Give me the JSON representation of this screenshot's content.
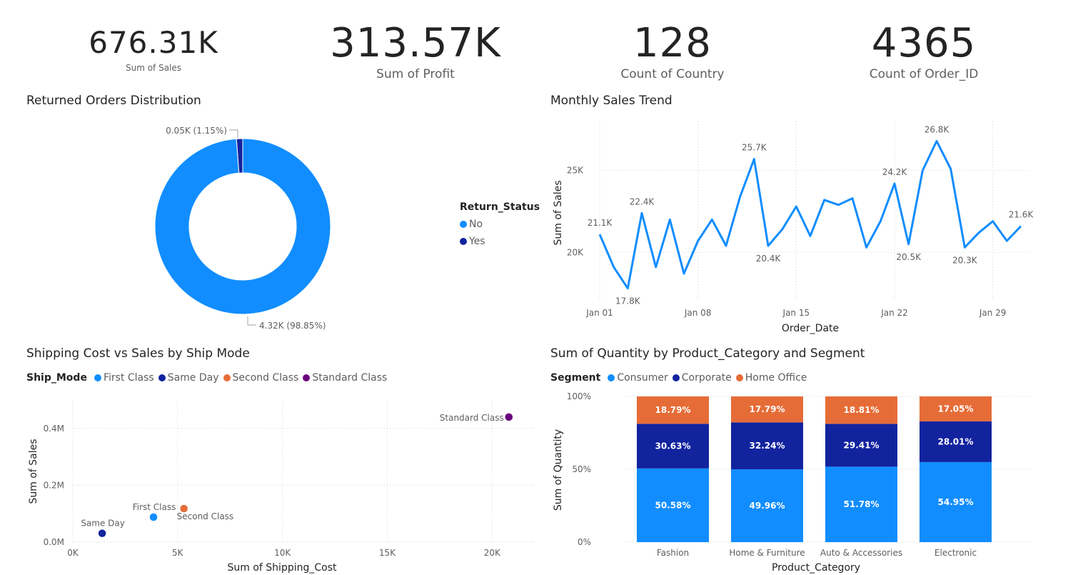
{
  "kpis": [
    {
      "value": "676.31K",
      "label": "Sum of Sales"
    },
    {
      "value": "313.57K",
      "label": "Sum of Profit"
    },
    {
      "value": "128",
      "label": "Count of Country"
    },
    {
      "value": "4365",
      "label": "Count of Order_ID"
    }
  ],
  "titles": {
    "returned": "Returned Orders Distribution",
    "monthly": "Monthly Sales Trend",
    "shipping": "Shipping Cost vs Sales by Ship Mode",
    "quantity": "Sum of Quantity by Product_Category and Segment"
  },
  "colors": {
    "light_blue": "#118dff",
    "dark_blue": "#12239e",
    "orange": "#e66c37",
    "purple": "#6b007b"
  },
  "chart_data": [
    {
      "type": "pie",
      "variant": "donut",
      "title": "Returned Orders Distribution",
      "legend_title": "Return_Status",
      "legend_position": "right",
      "slices": [
        {
          "name": "No",
          "value": 4.32,
          "unit": "K",
          "percent": 98.85,
          "label": "4.32K (98.85%)",
          "color": "#118dff"
        },
        {
          "name": "Yes",
          "value": 0.05,
          "unit": "K",
          "percent": 1.15,
          "label": "0.05K (1.15%)",
          "color": "#12239e"
        }
      ]
    },
    {
      "type": "line",
      "title": "Monthly Sales Trend",
      "xlabel": "Order_Date",
      "ylabel": "Sum of Sales",
      "x": [
        "Jan 01",
        "Jan 02",
        "Jan 03",
        "Jan 04",
        "Jan 05",
        "Jan 06",
        "Jan 07",
        "Jan 08",
        "Jan 09",
        "Jan 10",
        "Jan 11",
        "Jan 12",
        "Jan 13",
        "Jan 14",
        "Jan 15",
        "Jan 16",
        "Jan 17",
        "Jan 18",
        "Jan 19",
        "Jan 20",
        "Jan 21",
        "Jan 22",
        "Jan 23",
        "Jan 24",
        "Jan 25",
        "Jan 26",
        "Jan 27",
        "Jan 28",
        "Jan 29",
        "Jan 30",
        "Jan 31"
      ],
      "x_ticks": [
        "Jan 01",
        "Jan 08",
        "Jan 15",
        "Jan 22",
        "Jan 29"
      ],
      "y_ticks": [
        {
          "value": 20000,
          "label": "20K"
        },
        {
          "value": 25000,
          "label": "25K"
        }
      ],
      "ylim": [
        17000,
        28000
      ],
      "grid": true,
      "color": "#118dff",
      "values": [
        21100,
        19100,
        17800,
        22400,
        19100,
        22000,
        18700,
        20700,
        22000,
        20400,
        23400,
        25700,
        20400,
        21400,
        22800,
        21000,
        23200,
        22900,
        23300,
        20300,
        21900,
        24200,
        20500,
        25000,
        26800,
        25100,
        20300,
        21200,
        21900,
        20700,
        21600
      ],
      "data_labels": [
        {
          "index": 0,
          "label": "21.1K",
          "pos": "above"
        },
        {
          "index": 2,
          "label": "17.8K",
          "pos": "below"
        },
        {
          "index": 3,
          "label": "22.4K",
          "pos": "above"
        },
        {
          "index": 11,
          "label": "25.7K",
          "pos": "above"
        },
        {
          "index": 12,
          "label": "20.4K",
          "pos": "below"
        },
        {
          "index": 21,
          "label": "24.2K",
          "pos": "above"
        },
        {
          "index": 22,
          "label": "20.5K",
          "pos": "below"
        },
        {
          "index": 24,
          "label": "26.8K",
          "pos": "above"
        },
        {
          "index": 26,
          "label": "20.3K",
          "pos": "below"
        },
        {
          "index": 30,
          "label": "21.6K",
          "pos": "above"
        }
      ]
    },
    {
      "type": "scatter",
      "title": "Shipping Cost vs Sales by Ship Mode",
      "xlabel": "Sum of Shipping_Cost",
      "ylabel": "Sum of Sales",
      "legend_title": "Ship_Mode",
      "legend_position": "top-left",
      "xlim": [
        0,
        22000
      ],
      "ylim": [
        0,
        0.5
      ],
      "x_ticks": [
        {
          "value": 0,
          "label": "0K"
        },
        {
          "value": 5000,
          "label": "5K"
        },
        {
          "value": 10000,
          "label": "10K"
        },
        {
          "value": 15000,
          "label": "15K"
        },
        {
          "value": 20000,
          "label": "20K"
        }
      ],
      "y_ticks": [
        {
          "value": 0,
          "label": "0.0M"
        },
        {
          "value": 0.2,
          "label": "0.2M"
        },
        {
          "value": 0.4,
          "label": "0.4M"
        }
      ],
      "grid": true,
      "points": [
        {
          "name": "First Class",
          "x": 3850,
          "y": 0.088,
          "color": "#118dff",
          "label": "First Class",
          "label_pos": "above-left"
        },
        {
          "name": "Same Day",
          "x": 1400,
          "y": 0.031,
          "color": "#12239e",
          "label": "Same Day",
          "label_pos": "above-left"
        },
        {
          "name": "Second Class",
          "x": 5300,
          "y": 0.118,
          "color": "#e66c37",
          "label": "Second Class",
          "label_pos": "below-right"
        },
        {
          "name": "Standard Class",
          "x": 20800,
          "y": 0.44,
          "color": "#6b007b",
          "label": "Standard Class",
          "label_pos": "left"
        }
      ]
    },
    {
      "type": "bar",
      "variant": "stacked-100",
      "title": "Sum of Quantity by Product_Category and Segment",
      "xlabel": "Product_Category",
      "ylabel": "Sum of Quantity",
      "legend_title": "Segment",
      "legend_position": "top-left",
      "categories": [
        "Fashion",
        "Home & Furniture",
        "Auto & Accessories",
        "Electronic"
      ],
      "y_ticks": [
        {
          "value": 0,
          "label": "0%"
        },
        {
          "value": 50,
          "label": "50%"
        },
        {
          "value": 100,
          "label": "100%"
        }
      ],
      "ylim": [
        0,
        100
      ],
      "grid": true,
      "series": [
        {
          "name": "Consumer",
          "color": "#118dff",
          "values": [
            50.58,
            49.96,
            51.78,
            54.95
          ],
          "labels": [
            "50.58%",
            "49.96%",
            "51.78%",
            "54.95%"
          ]
        },
        {
          "name": "Corporate",
          "color": "#12239e",
          "values": [
            30.63,
            32.24,
            29.41,
            28.01
          ],
          "labels": [
            "30.63%",
            "32.24%",
            "29.41%",
            "28.01%"
          ]
        },
        {
          "name": "Home Office",
          "color": "#e66c37",
          "values": [
            18.79,
            17.79,
            18.81,
            17.05
          ],
          "labels": [
            "18.79%",
            "17.79%",
            "18.81%",
            "17.05%"
          ]
        }
      ]
    }
  ]
}
